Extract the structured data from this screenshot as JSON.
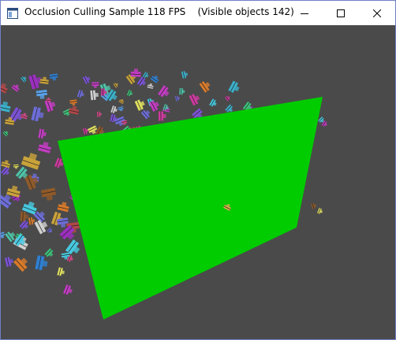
{
  "window": {
    "title": "Occlusion Culling Sample 118 FPS    (Visible objects 142)"
  },
  "titlebar": {
    "app_icon": "app-window-icon",
    "minimize_icon": "minimize-icon",
    "maximize_icon": "maximize-icon",
    "close_icon": "close-icon"
  },
  "scene": {
    "background_color": "#4a4a4a",
    "occluder_color": "#00cc00",
    "occluder_icon": "occluder-plane"
  }
}
